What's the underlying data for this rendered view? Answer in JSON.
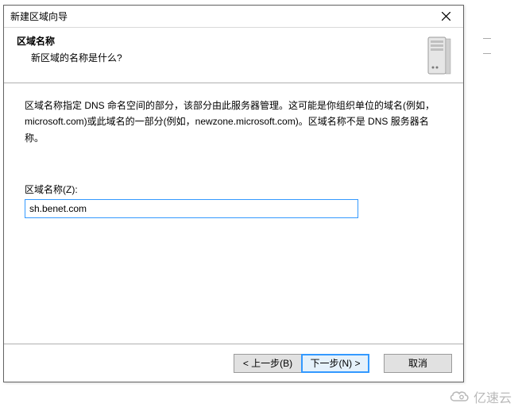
{
  "titlebar": {
    "title": "新建区域向导"
  },
  "banner": {
    "heading": "区域名称",
    "subtext": "新区域的名称是什么?"
  },
  "content": {
    "description": "区域名称指定 DNS 命名空间的部分，该部分由此服务器管理。这可能是你组织单位的域名(例如，microsoft.com)或此域名的一部分(例如，newzone.microsoft.com)。区域名称不是 DNS 服务器名称。",
    "field_label": "区域名称(Z):",
    "zone_value": "sh.benet.com"
  },
  "footer": {
    "back": "< 上一步(B)",
    "next": "下一步(N) >",
    "cancel": "取消"
  },
  "watermark": {
    "text": "亿速云"
  }
}
